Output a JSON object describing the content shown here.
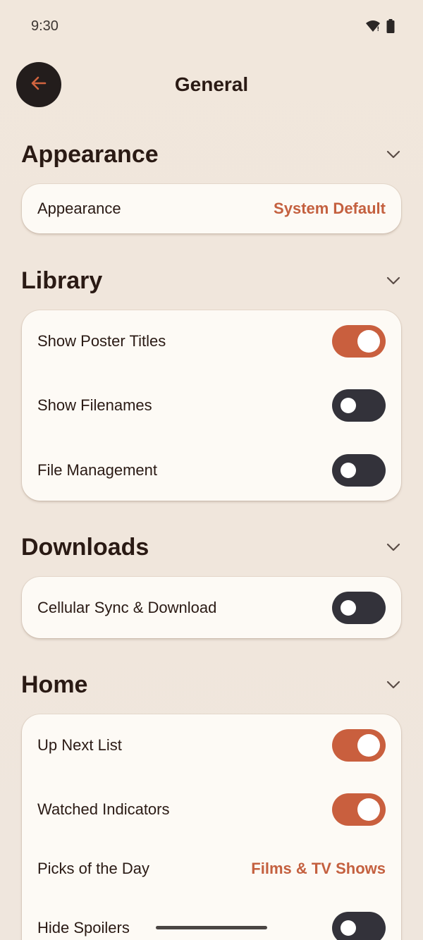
{
  "status_bar": {
    "time": "9:30"
  },
  "header": {
    "title": "General"
  },
  "sections": {
    "appearance": {
      "title": "Appearance",
      "rows": [
        {
          "label": "Appearance",
          "value": "System Default"
        }
      ]
    },
    "library": {
      "title": "Library",
      "rows": [
        {
          "label": "Show Poster Titles",
          "toggle": "on"
        },
        {
          "label": "Show Filenames",
          "toggle": "off"
        },
        {
          "label": "File Management",
          "toggle": "off"
        }
      ]
    },
    "downloads": {
      "title": "Downloads",
      "rows": [
        {
          "label": "Cellular Sync & Download",
          "toggle": "off"
        }
      ]
    },
    "home": {
      "title": "Home",
      "rows": [
        {
          "label": "Up Next List",
          "toggle": "on"
        },
        {
          "label": "Watched Indicators",
          "toggle": "on"
        },
        {
          "label": "Picks of the Day",
          "value": "Films & TV Shows"
        },
        {
          "label": "Hide Spoilers",
          "toggle": "off"
        }
      ]
    }
  },
  "colors": {
    "accent": "#c95f3e",
    "toggle_off": "#33323a",
    "card_bg": "#fdfaf5",
    "background": "#f0e6dc",
    "text": "#2a1a14"
  },
  "icons": {
    "back": "arrow-left-icon",
    "chevron": "chevron-down-icon",
    "wifi": "wifi-icon",
    "battery": "battery-icon"
  }
}
